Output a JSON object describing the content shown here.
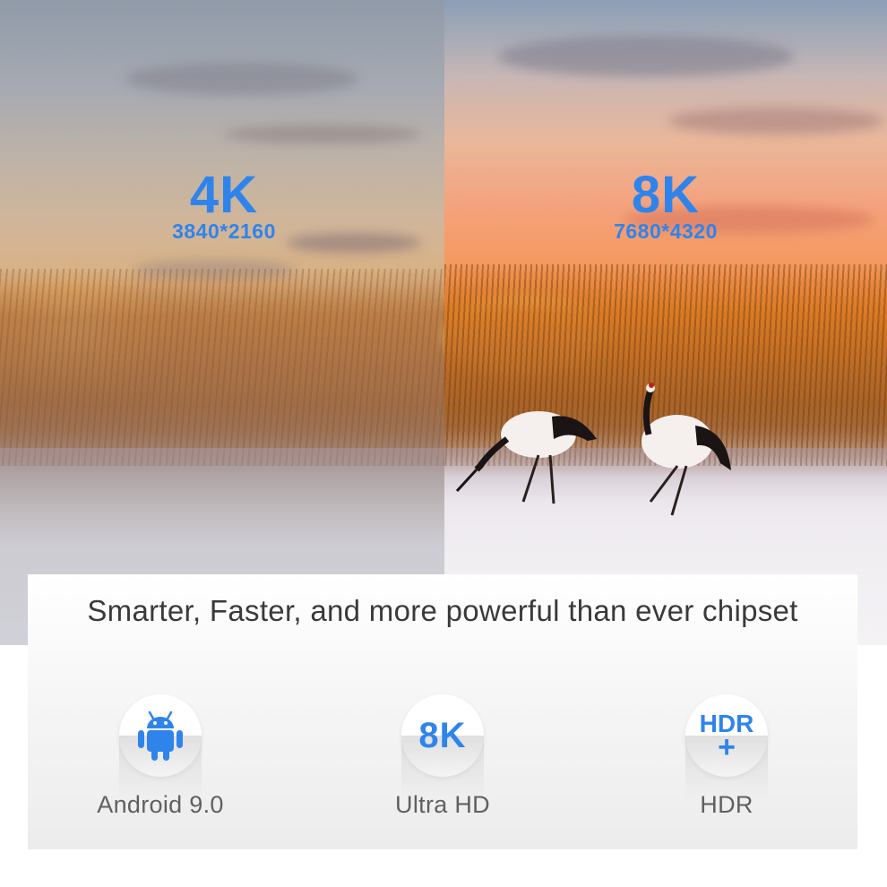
{
  "hero": {
    "left": {
      "title": "4K",
      "resolution": "3840*2160"
    },
    "right": {
      "title": "8K",
      "resolution": "7680*4320"
    }
  },
  "panel": {
    "tagline": "Smarter, Faster, and more powerful than ever chipset",
    "features": [
      {
        "icon": "android-icon",
        "label": "Android 9.0"
      },
      {
        "icon": "8k-badge-icon",
        "icon_text": "8K",
        "label": "Ultra HD"
      },
      {
        "icon": "hdr-badge-icon",
        "icon_text_top": "HDR",
        "icon_text_bottom": "+",
        "label": "HDR"
      }
    ]
  },
  "colors": {
    "accent": "#2f84ec",
    "label": "#606060",
    "tagline": "#3a3a3a"
  }
}
